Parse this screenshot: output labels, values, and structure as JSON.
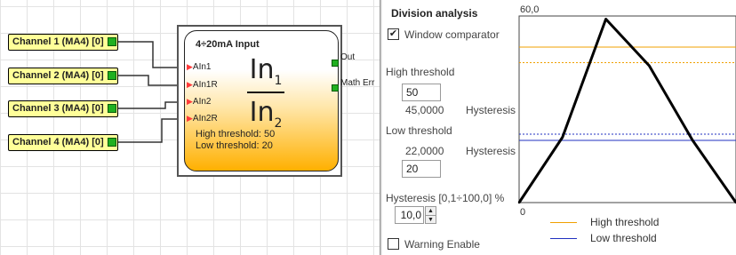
{
  "channels": [
    {
      "label": "Channel 1 (MA4) [0]"
    },
    {
      "label": "Channel 2 (MA4) [0]"
    },
    {
      "label": "Channel 3 (MA4) [0]"
    },
    {
      "label": "Channel 4 (MA4) [0]"
    }
  ],
  "block": {
    "title": "4÷20mA Input",
    "inputs": [
      "AIn1",
      "AIn1R",
      "AIn2",
      "AIn2R"
    ],
    "outputs": [
      "Out",
      "Math Err"
    ],
    "numerator": "In",
    "numerator_sub": "1",
    "denominator": "In",
    "denominator_sub": "2",
    "high_threshold_text": "High threshold: 50",
    "low_threshold_text": "Low threshold: 20"
  },
  "panel": {
    "title": "Division analysis",
    "window_comparator": {
      "label": "Window comparator",
      "checked": true,
      "mark": "✔"
    },
    "high": {
      "label": "High threshold",
      "value": "50",
      "computed": "45,0000",
      "hyst_label": "Hysteresis"
    },
    "low": {
      "label": "Low threshold",
      "computed": "22,0000",
      "hyst_label": "Hysteresis",
      "value": "20"
    },
    "hysteresis": {
      "label": "Hysteresis [0,1÷100,0] %",
      "value": "10,0"
    },
    "warning": {
      "label": "Warning Enable",
      "checked": false
    }
  },
  "chart_data": {
    "type": "line",
    "ylim": [
      0,
      60
    ],
    "ytick_top": "60,0",
    "ytick_bottom": "0",
    "series": [
      {
        "values": [
          [
            0,
            0
          ],
          [
            1,
            21
          ],
          [
            2,
            59
          ],
          [
            3,
            44
          ],
          [
            4,
            20
          ],
          [
            5,
            0
          ]
        ],
        "color": "#000000"
      }
    ],
    "thresholds": [
      {
        "name": "High threshold",
        "value": 50,
        "color": "#f0a000",
        "style": "solid"
      },
      {
        "value": 45,
        "color": "#f0a000",
        "style": "dotted"
      },
      {
        "value": 22,
        "color": "#2030c0",
        "style": "dotted"
      },
      {
        "name": "Low threshold",
        "value": 20,
        "color": "#2030c0",
        "style": "solid"
      }
    ],
    "legend": [
      "High threshold",
      "Low threshold"
    ],
    "colors": {
      "high": "#f0a000",
      "low": "#2030c0"
    }
  }
}
